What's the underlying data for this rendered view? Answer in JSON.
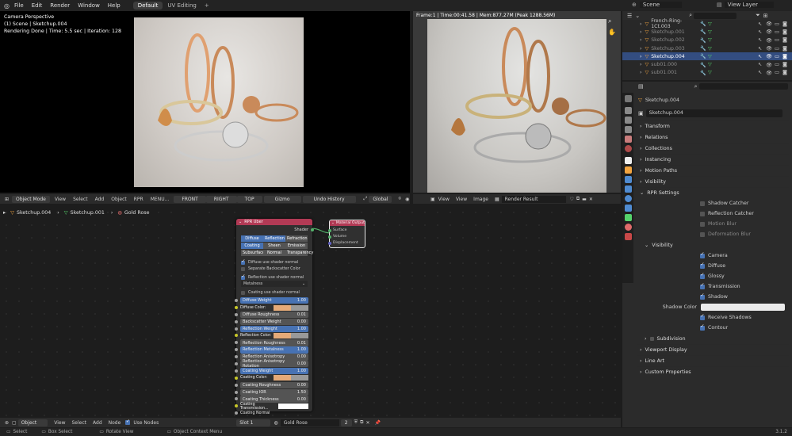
{
  "menubar": {
    "items": [
      "File",
      "Edit",
      "Render",
      "Window",
      "Help"
    ],
    "workspaces": [
      "Default",
      "UV Editing"
    ],
    "add_tab": "+",
    "scene": "Scene",
    "view_layer": "View Layer"
  },
  "viewport": {
    "overlay_lines": [
      "Camera Perspective",
      "(1) Scene | Sketchup.004",
      "Rendering Done | Time: 5.5 sec | Iteration: 128"
    ],
    "header": {
      "mode": "Object Mode",
      "menus": [
        "View",
        "Select",
        "Add",
        "Object",
        "RPR",
        "MENU..."
      ],
      "view_buttons": [
        "FRONT",
        "RIGHT",
        "TOP"
      ],
      "gizmo": "Gizmo",
      "undo": "Undo History",
      "orientation": "Global"
    }
  },
  "image_editor": {
    "status": "Frame:1 | Time:00:41.58 | Mem:877.27M (Peak 1288.56M)",
    "header": {
      "menus": [
        "View",
        "View",
        "Image"
      ],
      "image_name": "Render Result"
    }
  },
  "node_editor": {
    "breadcrumb": [
      "Sketchup.004",
      "Sketchup.001",
      "Gold Rose"
    ],
    "header": {
      "type": "Object",
      "menus": [
        "View",
        "Select",
        "Add",
        "Node"
      ],
      "use_nodes": "Use Nodes",
      "slot": "Slot 1",
      "material": "Gold Rose",
      "users": "2"
    },
    "uber_node": {
      "title": "RPR Uber",
      "output": "Shader",
      "tabs_row1": [
        "Diffuse",
        "Reflection",
        "Refraction"
      ],
      "tabs_row2": [
        "Coating",
        "Sheen",
        "Emission"
      ],
      "tabs_row3": [
        "Subsurface",
        "Normal",
        "Transparency"
      ],
      "opt1": "Diffuse use shader normal",
      "opt2": "Separate Backscatter Color",
      "opt3": "Reflection use shader normal",
      "metalness": "Metalness",
      "opt4": "Coating use shader normal",
      "params": [
        {
          "label": "Diffuse Weight",
          "value": "1.00",
          "style": "blue"
        },
        {
          "label": "Diffuse Color:",
          "value": "",
          "style": "color"
        },
        {
          "label": "Diffuse Roughness",
          "value": "0.01",
          "style": "grey"
        },
        {
          "label": "Backscatter Weight",
          "value": "0.00",
          "style": "grey"
        },
        {
          "label": "Reflection Weight",
          "value": "1.00",
          "style": "blue"
        },
        {
          "label": "Reflection Color:",
          "value": "",
          "style": "color"
        },
        {
          "label": "Reflection Roughness",
          "value": "0.01",
          "style": "grey"
        },
        {
          "label": "Reflection Metalness",
          "value": "1.00",
          "style": "blue"
        },
        {
          "label": "Reflection Anisotropy",
          "value": "0.00",
          "style": "grey"
        },
        {
          "label": "Reflection Anisotropy Rotation",
          "value": "0.00",
          "style": "grey"
        },
        {
          "label": "Coating Weight",
          "value": "1.00",
          "style": "blue"
        },
        {
          "label": "Coating Color:",
          "value": "",
          "style": "color"
        },
        {
          "label": "Coating Roughness",
          "value": "0.00",
          "style": "grey"
        },
        {
          "label": "Coating IOR",
          "value": "1.50",
          "style": "grey"
        },
        {
          "label": "Coating Thickness",
          "value": "0.00",
          "style": "grey"
        },
        {
          "label": "Coating Transmission...",
          "value": "",
          "style": "white"
        },
        {
          "label": "Coating Normal",
          "value": "",
          "style": "plain"
        }
      ]
    },
    "output_node": {
      "title": "Material Output",
      "sockets": [
        "Surface",
        "Volume",
        "Displacement"
      ]
    }
  },
  "outliner": {
    "rows": [
      {
        "name": "French-Ring-1Ct.003",
        "selected": false,
        "dim": false
      },
      {
        "name": "Sketchup.001",
        "selected": false,
        "dim": true
      },
      {
        "name": "Sketchup.002",
        "selected": false,
        "dim": true
      },
      {
        "name": "Sketchup.003",
        "selected": false,
        "dim": true
      },
      {
        "name": "Sketchup.004",
        "selected": true,
        "dim": false
      },
      {
        "name": "sub01.000",
        "selected": false,
        "dim": true
      },
      {
        "name": "sub01.001",
        "selected": false,
        "dim": true
      }
    ]
  },
  "properties": {
    "breadcrumb": "Sketchup.004",
    "object_name": "Sketchup.004",
    "sections": [
      "Transform",
      "Relations",
      "Collections",
      "Instancing",
      "Motion Paths",
      "Visibility"
    ],
    "rpr_settings": "RPR Settings",
    "rpr_options": [
      {
        "label": "Shadow Catcher",
        "on": false
      },
      {
        "label": "Reflection Catcher",
        "on": false
      },
      {
        "label": "Motion Blur",
        "on": false
      },
      {
        "label": "Deformation Blur",
        "on": false
      }
    ],
    "visibility_sub": "Visibility",
    "vis_options": [
      {
        "label": "Camera",
        "on": true
      },
      {
        "label": "Diffuse",
        "on": true
      },
      {
        "label": "Glossy",
        "on": true
      },
      {
        "label": "Transmission",
        "on": true
      },
      {
        "label": "Shadow",
        "on": true
      }
    ],
    "shadow_color_label": "Shadow Color",
    "vis_options2": [
      {
        "label": "Receive Shadows",
        "on": true
      },
      {
        "label": "Contour",
        "on": true
      }
    ],
    "subdivision": "Subdivision",
    "more_sections": [
      "Viewport Display",
      "Line Art",
      "Custom Properties"
    ]
  },
  "statusbar": {
    "items": [
      "Select",
      "Box Select",
      "Rotate View",
      "Object Context Menu"
    ],
    "version": "3.1.2"
  },
  "colors": {
    "accent": "#4772b3",
    "selected_row": "#334d80",
    "node_header": "#b23a55",
    "gold": "#e5aa78"
  }
}
